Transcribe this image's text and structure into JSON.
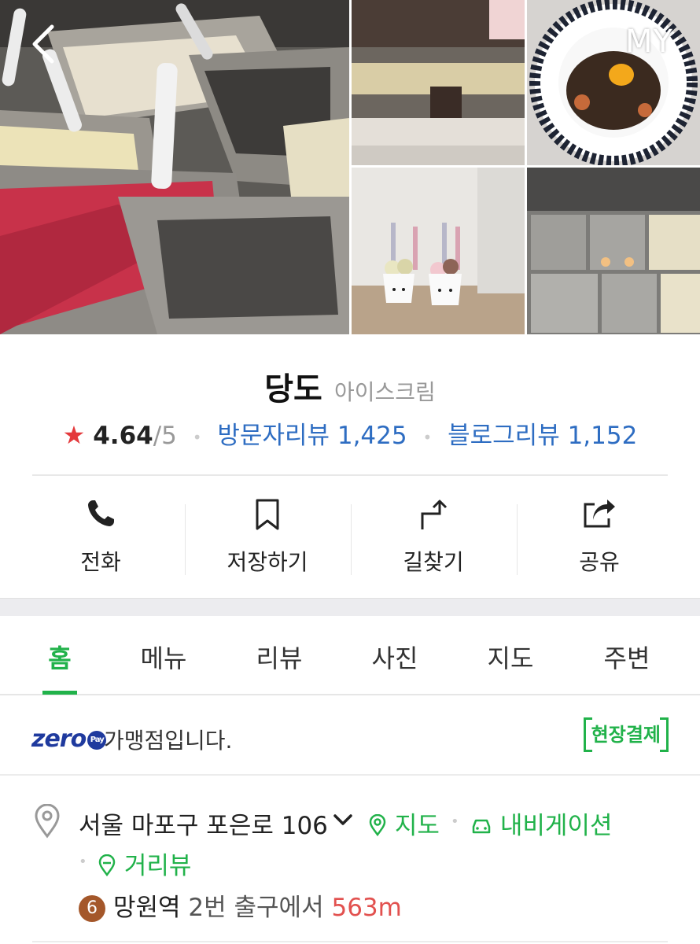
{
  "header": {
    "my_label": "MY"
  },
  "place": {
    "name": "당도",
    "category": "아이스크림",
    "rating": "4.64",
    "rating_max": "/5",
    "visitor_reviews": "방문자리뷰 1,425",
    "blog_reviews": "블로그리뷰 1,152"
  },
  "actions": [
    {
      "label": "전화",
      "icon": "phone-icon"
    },
    {
      "label": "저장하기",
      "icon": "bookmark-icon"
    },
    {
      "label": "길찾기",
      "icon": "directions-icon"
    },
    {
      "label": "공유",
      "icon": "share-icon"
    }
  ],
  "tabs": [
    {
      "label": "홈",
      "active": true
    },
    {
      "label": "메뉴"
    },
    {
      "label": "리뷰"
    },
    {
      "label": "사진"
    },
    {
      "label": "지도"
    },
    {
      "label": "주변"
    }
  ],
  "zeropay": {
    "logo": "zero",
    "logo_badge": "Pay",
    "text": "가맹점입니다.",
    "onsite_label": "현장결제"
  },
  "address": {
    "text": "서울 마포구 포은로 106",
    "map_link": "지도",
    "navigation_link": "내비게이션",
    "street_view_link": "거리뷰"
  },
  "subway": {
    "line_number": "6",
    "station": "망원역",
    "exit": "2번 출구에서",
    "distance": "563m"
  },
  "colors": {
    "accent_green": "#21b24a",
    "link_blue": "#2e6dc2",
    "star_red": "#e4393c",
    "distance_red": "#e2514f",
    "line6_brown": "#a4572a"
  }
}
